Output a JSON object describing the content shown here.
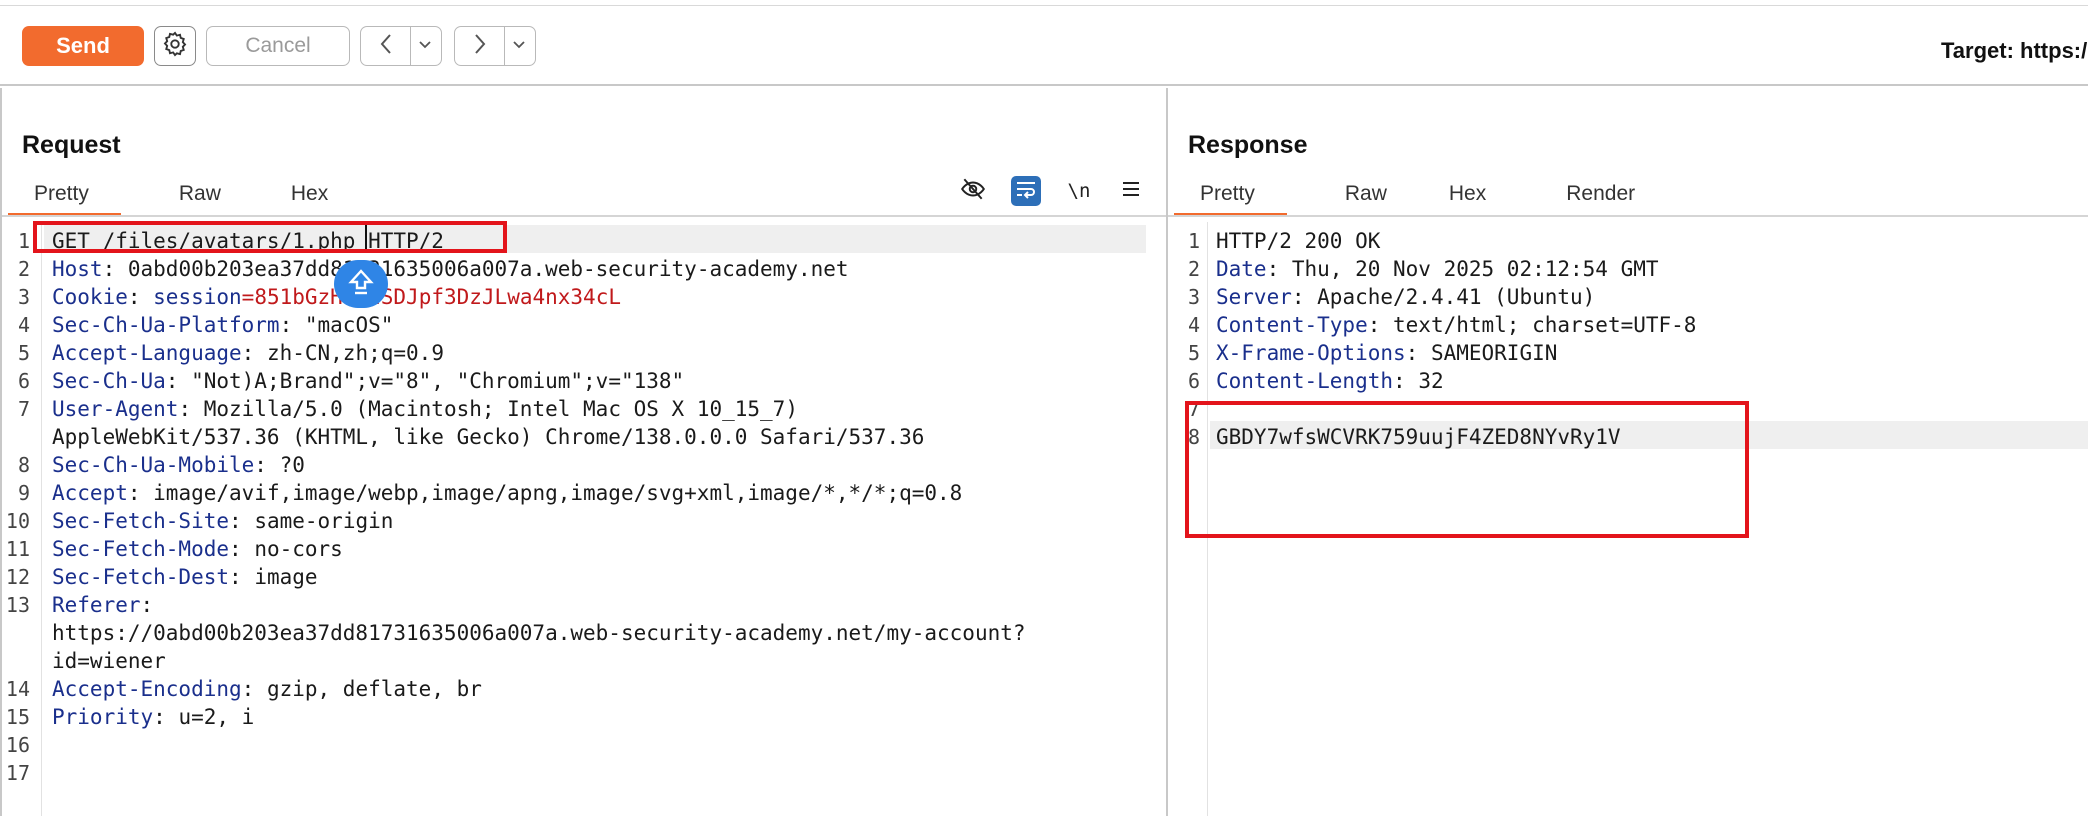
{
  "toolbar": {
    "send_label": "Send",
    "cancel_label": "Cancel",
    "target_label": "Target: https:/",
    "icons": [
      "gear-icon",
      "chevron-left-icon",
      "chevron-down-icon",
      "chevron-right-icon"
    ]
  },
  "request": {
    "title": "Request",
    "tabs": [
      "Pretty",
      "Raw",
      "Hex"
    ],
    "active_tab": "Pretty",
    "tool_icons": [
      "eye-off-icon",
      "wrap-lines-icon",
      "newline-icon",
      "menu-icon"
    ],
    "newline_glyph": "\\n",
    "lines": [
      {
        "n": "1",
        "key": "",
        "sep": "",
        "val": "GET /files/avatars/1.php HTTP/2"
      },
      {
        "n": "2",
        "key": "Host",
        "sep": ": ",
        "val": "0abd00b203ea37dd81731635006a007a.web-security-academy.net"
      },
      {
        "n": "3",
        "key": "Cookie",
        "sep": ": ",
        "val": "session=851bGzHdUdSDJpf3DzJLwa4nx34cL",
        "cookie_key": "session",
        "cookie_eq": "=",
        "cookie_val": "851bGzHdUdSDJpf3DzJLwa4nx34cL"
      },
      {
        "n": "4",
        "key": "Sec-Ch-Ua-Platform",
        "sep": ": ",
        "val": "\"macOS\""
      },
      {
        "n": "5",
        "key": "Accept-Language",
        "sep": ": ",
        "val": "zh-CN,zh;q=0.9"
      },
      {
        "n": "6",
        "key": "Sec-Ch-Ua",
        "sep": ": ",
        "val": "\"Not)A;Brand\";v=\"8\", \"Chromium\";v=\"138\""
      },
      {
        "n": "7",
        "key": "User-Agent",
        "sep": ": ",
        "val": "Mozilla/5.0 (Macintosh; Intel Mac OS X 10_15_7)"
      },
      {
        "n": "",
        "key": "",
        "sep": "",
        "val": "AppleWebKit/537.36 (KHTML, like Gecko) Chrome/138.0.0.0 Safari/537.36"
      },
      {
        "n": "8",
        "key": "Sec-Ch-Ua-Mobile",
        "sep": ": ",
        "val": "?0"
      },
      {
        "n": "9",
        "key": "Accept",
        "sep": ": ",
        "val": "image/avif,image/webp,image/apng,image/svg+xml,image/*,*/*;q=0.8"
      },
      {
        "n": "10",
        "key": "Sec-Fetch-Site",
        "sep": ": ",
        "val": "same-origin"
      },
      {
        "n": "11",
        "key": "Sec-Fetch-Mode",
        "sep": ": ",
        "val": "no-cors"
      },
      {
        "n": "12",
        "key": "Sec-Fetch-Dest",
        "sep": ": ",
        "val": "image"
      },
      {
        "n": "13",
        "key": "Referer",
        "sep": ":",
        "val": ""
      },
      {
        "n": "",
        "key": "",
        "sep": "",
        "val": "https://0abd00b203ea37dd81731635006a007a.web-security-academy.net/my-account?"
      },
      {
        "n": "",
        "key": "",
        "sep": "",
        "val": "id=wiener"
      },
      {
        "n": "14",
        "key": "Accept-Encoding",
        "sep": ": ",
        "val": "gzip, deflate, br"
      },
      {
        "n": "15",
        "key": "Priority",
        "sep": ": ",
        "val": "u=2, i"
      },
      {
        "n": "16",
        "key": "",
        "sep": "",
        "val": ""
      },
      {
        "n": "17",
        "key": "",
        "sep": "",
        "val": ""
      }
    ]
  },
  "response": {
    "title": "Response",
    "tabs": [
      "Pretty",
      "Raw",
      "Hex",
      "Render"
    ],
    "active_tab": "Pretty",
    "lines": [
      {
        "n": "1",
        "key": "",
        "sep": "",
        "val": "HTTP/2 200 OK"
      },
      {
        "n": "2",
        "key": "Date",
        "sep": ": ",
        "val": "Thu, 20 Nov 2025 02:12:54 GMT"
      },
      {
        "n": "3",
        "key": "Server",
        "sep": ": ",
        "val": "Apache/2.4.41 (Ubuntu)"
      },
      {
        "n": "4",
        "key": "Content-Type",
        "sep": ": ",
        "val": "text/html; charset=UTF-8"
      },
      {
        "n": "5",
        "key": "X-Frame-Options",
        "sep": ": ",
        "val": "SAMEORIGIN"
      },
      {
        "n": "6",
        "key": "Content-Length",
        "sep": ": ",
        "val": "32"
      },
      {
        "n": "7",
        "key": "",
        "sep": "",
        "val": ""
      },
      {
        "n": "8",
        "key": "",
        "sep": "",
        "val": "GBDY7wfsWCVRK759uujF4ZED8NYvRy1V"
      }
    ]
  },
  "colors": {
    "accent": "#f26b2e",
    "header_key": "#1a2f8c",
    "cookie_value": "#c0191b",
    "highlight_box": "#e3141b"
  }
}
